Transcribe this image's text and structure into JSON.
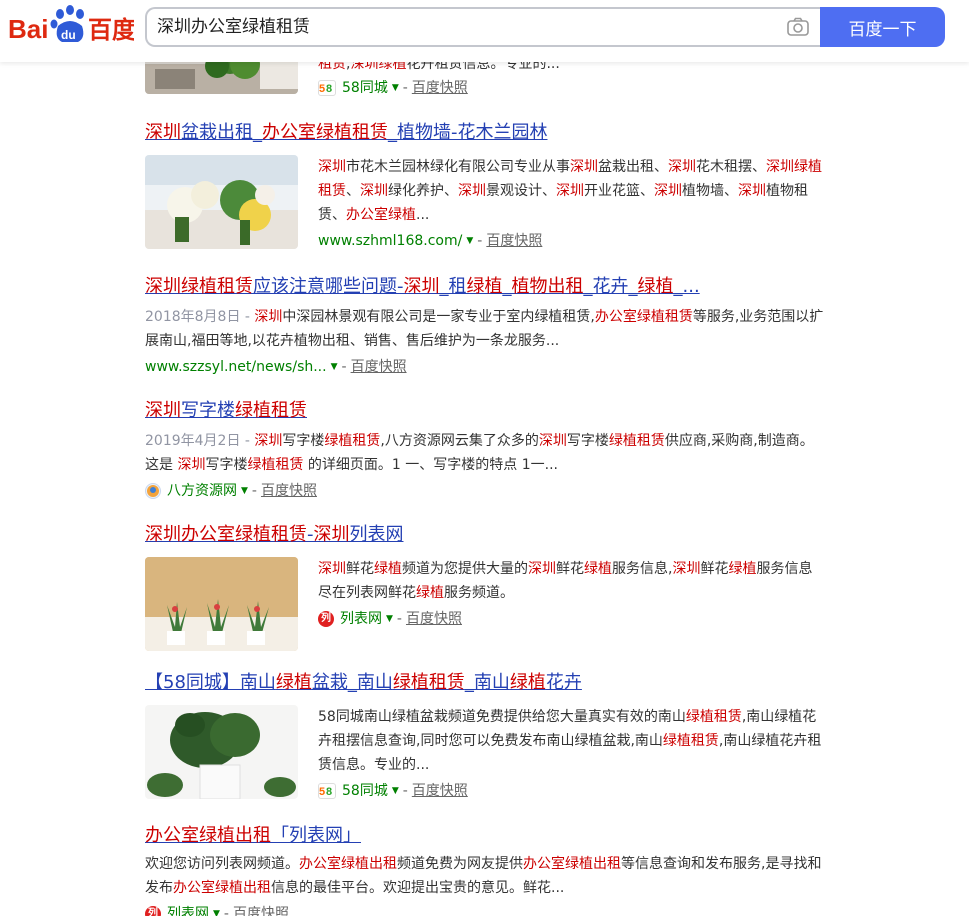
{
  "header": {
    "logo_text": "Bai du 百度",
    "search_value": "深圳办公室绿植租赁",
    "search_button": "百度一下"
  },
  "results": [
    {
      "snippet_partial": "租赁,深圳绿植花卉租赁信息。专业的...",
      "source": "58同城",
      "snapshot": "百度快照"
    },
    {
      "title": "深圳盆栽出租_办公室绿植租赁_植物墙-花木兰园林",
      "snippet": "深圳市花木兰园林绿化有限公司专业从事深圳盆栽出租、深圳花木租摆、深圳绿植租赁、深圳绿化养护、深圳景观设计、深圳开业花篮、深圳植物墙、深圳植物租赁、办公室绿植...",
      "source": "www.szhml168.com/",
      "snapshot": "百度快照"
    },
    {
      "title": "深圳绿植租赁应该注意哪些问题-深圳_租绿植_植物出租_花卉_绿植_...",
      "date": "2018年8月8日 - ",
      "snippet": "深圳中深园林景观有限公司是一家专业于室内绿植租赁,办公室绿植租赁等服务,业务范围以扩展南山,福田等地,以花卉植物出租、销售、售后维护为一条龙服务...",
      "source": "www.szzsyl.net/news/sh...",
      "snapshot": "百度快照"
    },
    {
      "title": "深圳写字楼绿植租赁",
      "date": "2019年4月2日 - ",
      "snippet": "深圳写字楼绿植租赁,八方资源网云集了众多的深圳写字楼绿植租赁供应商,采购商,制造商。这是 深圳写字楼绿植租赁 的详细页面。1 一、写字楼的特点 1一...",
      "source": "八方资源网",
      "snapshot": "百度快照"
    },
    {
      "title": "深圳办公室绿植租赁-深圳列表网",
      "snippet": "深圳鲜花绿植频道为您提供大量的深圳鲜花绿植服务信息,深圳鲜花绿植服务信息尽在列表网鲜花绿植服务频道。",
      "source": "列表网",
      "snapshot": "百度快照"
    },
    {
      "title": "【58同城】南山绿植盆栽_南山绿植租赁_南山绿植花卉",
      "snippet": "58同城南山绿植盆栽频道免费提供给您大量真实有效的南山绿植租赁,南山绿植花卉租摆信息查询,同时您可以免费发布南山绿植盆栽,南山绿植租赁,南山绿植花卉租赁信息。专业的...",
      "source": "58同城",
      "snapshot": "百度快照"
    },
    {
      "title": "办公室绿植出租 「列表网」",
      "snippet": "欢迎您访问列表网频道。办公室绿植出租频道免费为网友提供办公室绿植出租等信息查询和发布服务,是寻找和发布办公室绿植出租信息的最佳平台。欢迎提出宝贵的意见。鲜花...",
      "source": "列表网",
      "snapshot": "百度快照"
    }
  ],
  "colors": {
    "title_link": "#2440b3",
    "highlight": "#cc0000",
    "source_green": "#008000",
    "search_button": "#4e6ef2"
  }
}
